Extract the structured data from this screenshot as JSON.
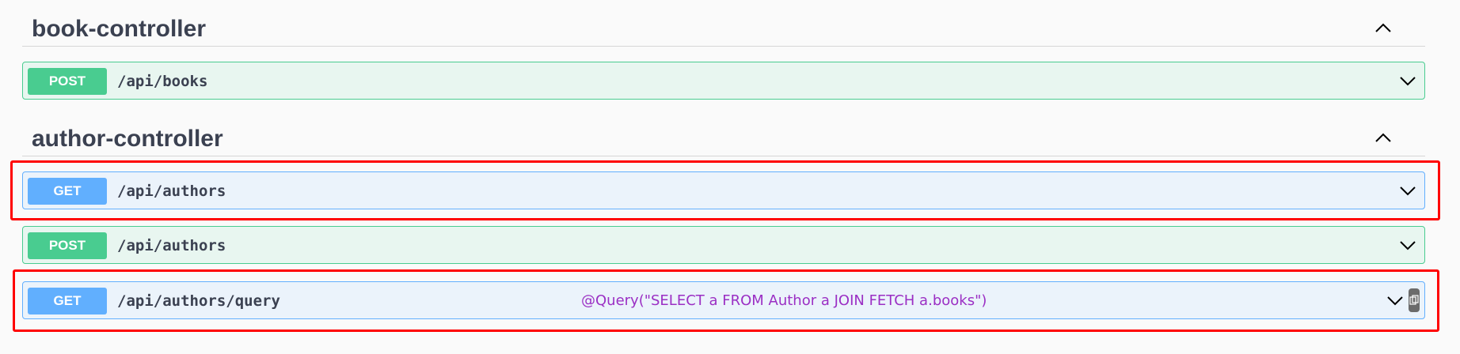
{
  "sections": [
    {
      "title": "book-controller",
      "operations": [
        {
          "method": "POST",
          "path": "/api/books"
        }
      ]
    },
    {
      "title": "author-controller",
      "operations": [
        {
          "method": "GET",
          "path": "/api/authors"
        },
        {
          "method": "POST",
          "path": "/api/authors"
        },
        {
          "method": "GET",
          "path": "/api/authors/query",
          "annotation": "@Query(\"SELECT a FROM Author a JOIN FETCH a.books\")"
        }
      ]
    }
  ],
  "icons": {
    "collapse": "chevron-up-icon",
    "expand": "chevron-down-icon",
    "copy": "copy-icon"
  },
  "colors": {
    "post_accent": "#49cc90",
    "post_bg": "#e8f6f0",
    "get_accent": "#61affe",
    "get_bg": "#ebf3fb",
    "highlight": "#ff0000",
    "annotation_text": "#9b2fc4"
  }
}
